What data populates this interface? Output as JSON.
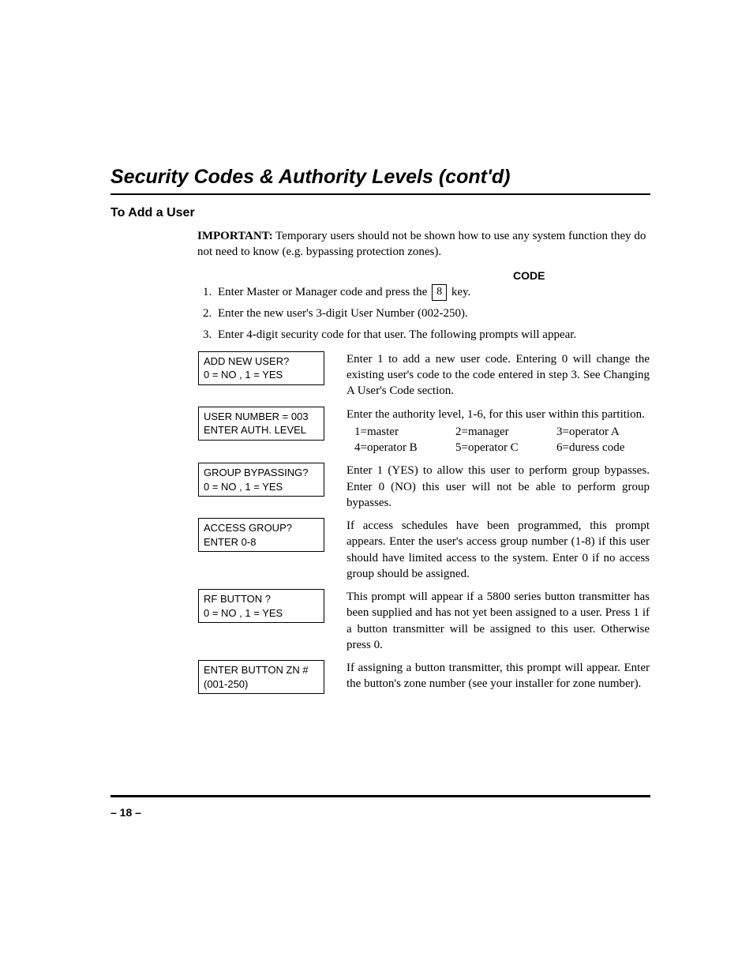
{
  "title": "Security Codes & Authority Levels (cont'd)",
  "subhead": "To Add a User",
  "important_label": "IMPORTANT:",
  "important_text": " Temporary users should not be shown how to use any system function they do not need to know (e.g. bypassing protection zones).",
  "code_label": "CODE",
  "step1_before": "Enter Master or Manager code and press the",
  "step1_key": "8",
  "step1_after": "key.",
  "step2": "Enter the new user's 3-digit User Number (002-250).",
  "step3": "Enter 4-digit security code for that user. The following prompts will appear.",
  "prompts": [
    {
      "lcd1": "ADD NEW USER?",
      "lcd2": "0  = NO , 1  = YES",
      "desc": "Enter 1 to add a new user code. Entering 0 will change the existing user's code to the code entered in step 3. See Changing A User's Code section."
    },
    {
      "lcd1": "USER NUMBER = 003",
      "lcd2": "ENTER AUTH. LEVEL",
      "desc_pre": "Enter the authority level, 1-6, for this user within this partition.",
      "auth": {
        "a1": "1=master",
        "a2": "2=manager",
        "a3": "3=operator A",
        "a4": "4=operator B",
        "a5": "5=operator C",
        "a6": "6=duress code"
      }
    },
    {
      "lcd1": "GROUP BYPASSING?",
      "lcd2": "0 = NO , 1 = YES",
      "desc": "Enter 1 (YES) to allow this user to perform group bypasses. Enter 0 (NO) this user will not be able to perform group bypasses."
    },
    {
      "lcd1": "ACCESS  GROUP?",
      "lcd2": "ENTER 0-8",
      "desc": "If access schedules have been programmed, this prompt appears. Enter the user's access group number (1-8) if this user should have limited access to the system. Enter 0 if no access group should be assigned."
    },
    {
      "lcd1": "RF BUTTON ?",
      "lcd2": "0 = NO , 1 = YES",
      "desc": "This prompt will appear if a 5800 series button transmitter has been supplied and has not yet been assigned to a user. Press 1 if a button transmitter will be assigned to this user. Otherwise press 0."
    },
    {
      "lcd1": "ENTER BUTTON ZN #",
      "lcd2": "(001-250)",
      "desc": "If assigning a button transmitter, this prompt will appear. Enter the button's zone number (see your installer for zone number)."
    }
  ],
  "page_number": "– 18 –"
}
